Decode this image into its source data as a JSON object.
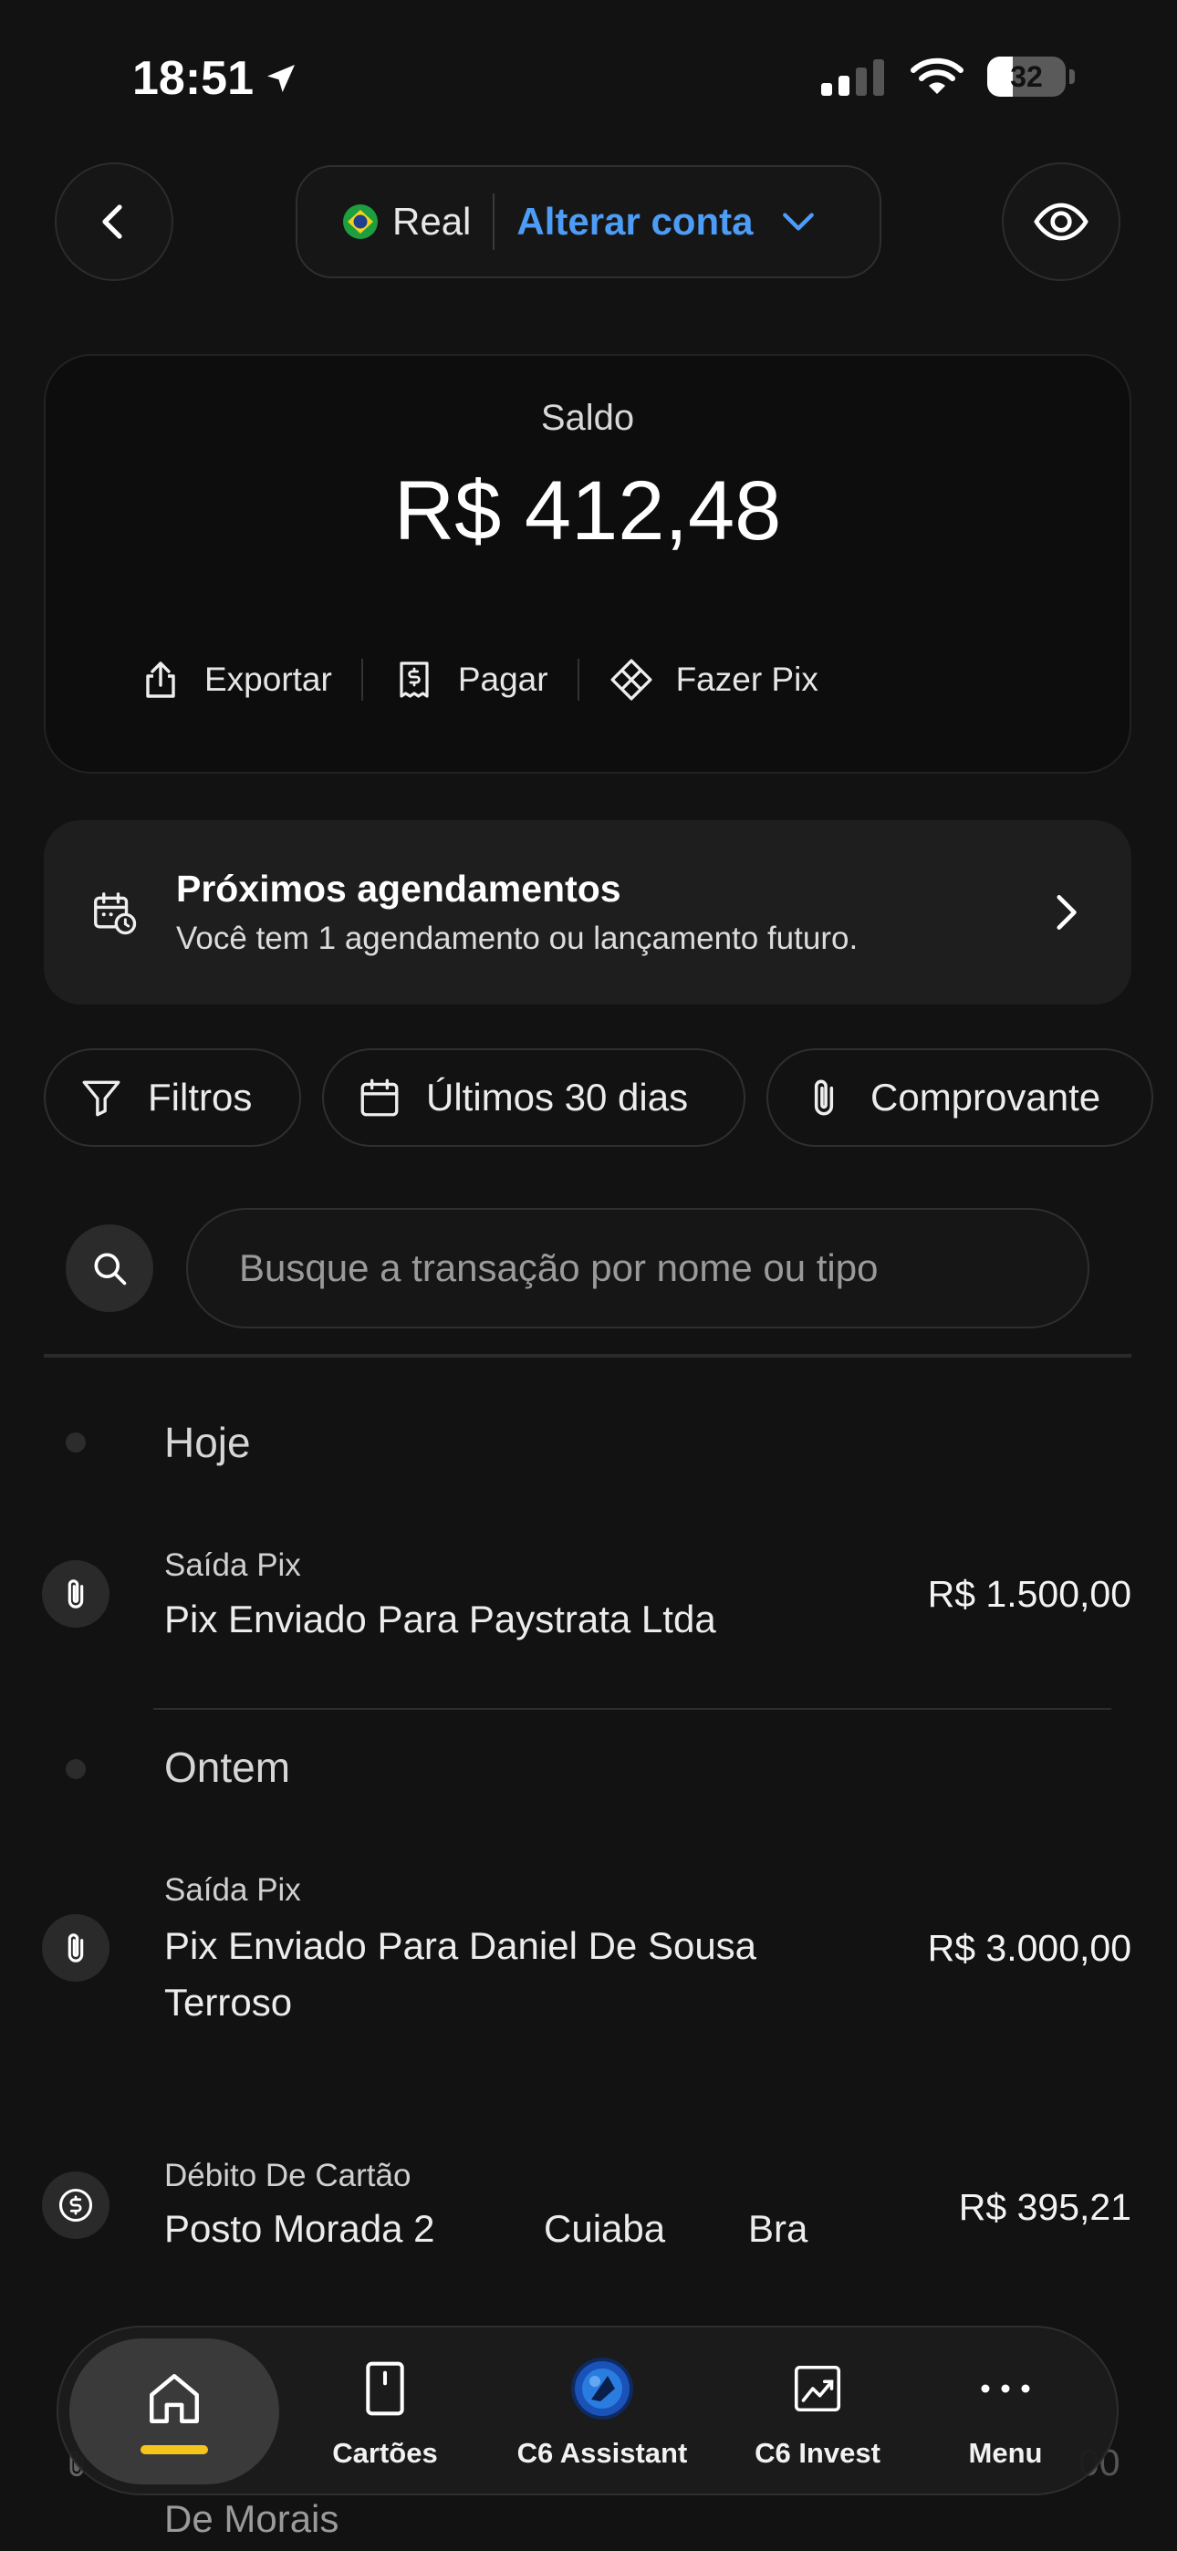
{
  "status_bar": {
    "time": "18:51",
    "battery": 32
  },
  "account": {
    "name": "Real",
    "change_label": "Alterar conta"
  },
  "balance": {
    "label": "Saldo",
    "value": "R$ 412,48"
  },
  "actions": [
    {
      "label": "Exportar",
      "icon": "share-icon"
    },
    {
      "label": "Pagar",
      "icon": "receipt-dollar-icon"
    },
    {
      "label": "Fazer Pix",
      "icon": "pix-icon"
    }
  ],
  "schedule": {
    "title": "Próximos agendamentos",
    "subtitle": "Você tem 1 agendamento ou lançamento futuro."
  },
  "filters": {
    "filter_label": "Filtros",
    "period_label": "Últimos 30 dias",
    "receipt_label": "Comprovante"
  },
  "search": {
    "placeholder": "Busque a transação por nome ou tipo"
  },
  "groups": [
    {
      "day": "Hoje",
      "transactions": [
        {
          "type": "Saída Pix",
          "name": "Pix Enviado Para Paystrata Ltda",
          "amount": "R$ 1.500,00",
          "icon": "paperclip-icon"
        }
      ]
    },
    {
      "day": "Ontem",
      "transactions": [
        {
          "type": "Saída Pix",
          "name": "Pix Enviado Para Daniel De Sousa Terroso",
          "amount": "R$ 3.000,00",
          "icon": "paperclip-icon"
        },
        {
          "type": "Débito De Cartão",
          "name": "Posto Morada 2",
          "city": "Cuiaba",
          "country": "Bra",
          "amount": "R$ 395,21",
          "icon": "dollar-circle-icon"
        },
        {
          "name": "De Morais",
          "amount_partial": "00",
          "icon": "paperclip-icon"
        }
      ]
    }
  ],
  "bottom_nav": [
    {
      "label": "",
      "icon": "home-icon",
      "active": true
    },
    {
      "label": "Cartões",
      "icon": "card-icon"
    },
    {
      "label": "C6 Assistant",
      "icon": "assistant-orb-icon"
    },
    {
      "label": "C6 Invest",
      "icon": "chart-icon"
    },
    {
      "label": "Menu",
      "icon": "more-dots-icon"
    }
  ],
  "colors": {
    "background": "#121212",
    "accent_blue": "#4d9cf6",
    "home_indicator": "#f6c51c"
  }
}
